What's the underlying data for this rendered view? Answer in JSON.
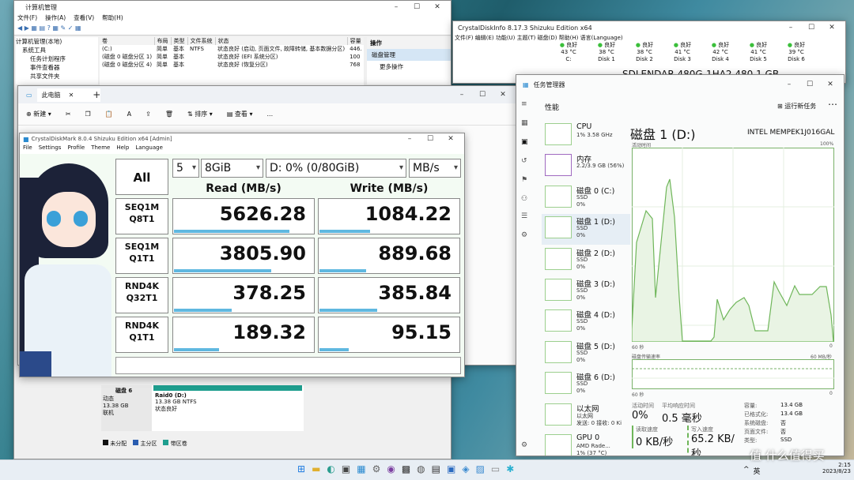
{
  "cm": {
    "title": "计算机管理",
    "menu": [
      "文件(F)",
      "操作(A)",
      "查看(V)",
      "帮助(H)"
    ],
    "tree": [
      "计算机管理(本地)",
      "系统工具",
      "任务计划程序",
      "事件查看器",
      "共享文件夹"
    ],
    "cols": [
      "卷",
      "布局",
      "类型",
      "文件系统",
      "状态",
      "容量"
    ],
    "rows": [
      [
        "(C:)",
        "简单",
        "基本",
        "NTFS",
        "状态良好 (启动, 页面文件, 故障转储, 基本数据分区)",
        "446."
      ],
      [
        "(磁盘 0 磁盘分区 1)",
        "简单",
        "基本",
        "",
        "状态良好 (EFI 系统分区)",
        "100"
      ],
      [
        "(磁盘 0 磁盘分区 4)",
        "简单",
        "基本",
        "",
        "状态良好 (恢复分区)",
        "768"
      ]
    ],
    "actions_title": "操作",
    "actions": [
      "磁盘管理",
      "更多操作"
    ],
    "disk6": {
      "name": "磁盘 6",
      "type": "动态",
      "size": "13.38 GB",
      "state": "联机",
      "vol": "Raid0  (D:)",
      "volsize": "13.38 GB NTFS",
      "volstate": "状态良好"
    },
    "legend": [
      "未分配",
      "主分区",
      "带区卷"
    ]
  },
  "cd": {
    "title": "CrystalDiskInfo 8.17.3 Shizuku Edition x64",
    "menu": "文件(F)  编辑(E)  功能(U)  主题(T)  磁盘(D)  帮助(H)  语言(Language)",
    "disks": [
      {
        "st": "良好",
        "t": "43 °C",
        "n": "C:"
      },
      {
        "st": "良好",
        "t": "38 °C",
        "n": "Disk 1"
      },
      {
        "st": "良好",
        "t": "38 °C",
        "n": "Disk 2"
      },
      {
        "st": "良好",
        "t": "41 °C",
        "n": "Disk 3"
      },
      {
        "st": "良好",
        "t": "42 °C",
        "n": "Disk 4"
      },
      {
        "st": "良好",
        "t": "41 °C",
        "n": "Disk 5"
      },
      {
        "st": "良好",
        "t": "39 °C",
        "n": "Disk 6"
      }
    ],
    "model": "SDLENDAR-480G-1HA2 480.1 GB"
  },
  "ex": {
    "title": "此电脑",
    "toolbar": [
      "新建",
      "排序",
      "查看",
      "..."
    ]
  },
  "cdm": {
    "title": "CrystalDiskMark 8.0.4 Shizuku Edition x64 [Admin]",
    "menu": [
      "File",
      "Settings",
      "Profile",
      "Theme",
      "Help",
      "Language"
    ],
    "all": "All",
    "count": "5",
    "size": "8GiB",
    "drive": "D: 0% (0/80GiB)",
    "unit": "MB/s",
    "read_h": "Read (MB/s)",
    "write_h": "Write (MB/s)",
    "tests": [
      {
        "l1": "SEQ1M",
        "l2": "Q8T1",
        "r": "5626.28",
        "w": "1084.22",
        "rf": 0.82,
        "wf": 0.36
      },
      {
        "l1": "SEQ1M",
        "l2": "Q1T1",
        "r": "3805.90",
        "w": "889.68",
        "rf": 0.69,
        "wf": 0.33
      },
      {
        "l1": "RND4K",
        "l2": "Q32T1",
        "r": "378.25",
        "w": "385.84",
        "rf": 0.41,
        "wf": 0.41
      },
      {
        "l1": "RND4K",
        "l2": "Q1T1",
        "r": "189.32",
        "w": "95.15",
        "rf": 0.32,
        "wf": 0.21
      }
    ]
  },
  "tm": {
    "title": "任务管理器",
    "section": "性能",
    "run": "运行新任务",
    "heading": "磁盘 1 (D:)",
    "model": "INTEL MEMPEK1J016GAL",
    "active": "活动时间",
    "pct": "100%",
    "t60": "60 秒",
    "zero": "0",
    "rate": "磁盘传输速率",
    "rmax": "60 MB/秒",
    "items": [
      {
        "n": "CPU",
        "a": "1% 3.58 GHz",
        "b": ""
      },
      {
        "n": "内存",
        "a": "2.2/3.9 GB (56%)",
        "b": ""
      },
      {
        "n": "磁盘 0 (C:)",
        "a": "SSD",
        "b": "0%"
      },
      {
        "n": "磁盘 1 (D:)",
        "a": "SSD",
        "b": "0%"
      },
      {
        "n": "磁盘 2 (D:)",
        "a": "SSD",
        "b": "0%"
      },
      {
        "n": "磁盘 3 (D:)",
        "a": "SSD",
        "b": "0%"
      },
      {
        "n": "磁盘 4 (D:)",
        "a": "SSD",
        "b": "0%"
      },
      {
        "n": "磁盘 5 (D:)",
        "a": "SSD",
        "b": "0%"
      },
      {
        "n": "磁盘 6 (D:)",
        "a": "SSD",
        "b": "0%"
      },
      {
        "n": "以太网",
        "a": "以太网",
        "b": "发送: 0 接收: 0 Ki"
      },
      {
        "n": "GPU 0",
        "a": "AMD Rade...",
        "b": "1% (37 °C)"
      }
    ],
    "s": {
      "act_k": "活动时间",
      "act_v": "0%",
      "avg_k": "平均响应时间",
      "avg_v": "0.5 毫秒",
      "rd_k": "读取速度",
      "rd_v": "0 KB/秒",
      "wr_k": "写入速度",
      "wr_v": "65.2 KB/秒"
    },
    "props": [
      [
        "容量:",
        "13.4 GB"
      ],
      [
        "已格式化:",
        "13.4 GB"
      ],
      [
        "系统磁盘:",
        "否"
      ],
      [
        "页面文件:",
        "否"
      ],
      [
        "类型:",
        "SSD"
      ]
    ]
  },
  "taskbar": {
    "ime": "英",
    "time": "2:15",
    "date": "2023/8/23"
  },
  "watermark": "值 什么值得买"
}
